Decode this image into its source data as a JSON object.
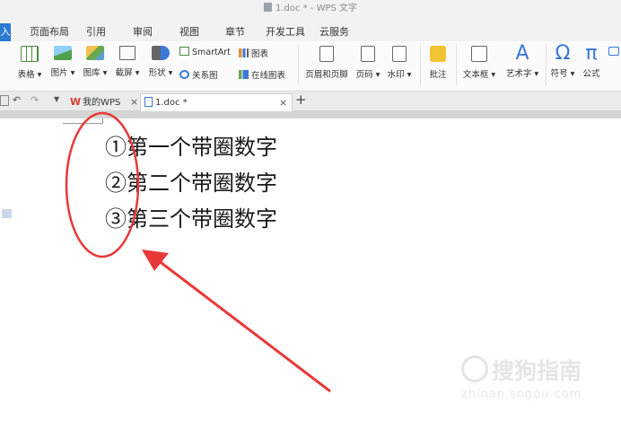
{
  "window": {
    "title": "1.doc * - WPS 文字"
  },
  "menu_tabs": [
    "入",
    "页面布局",
    "引用",
    "审阅",
    "视图",
    "章节",
    "开发工具",
    "云服务"
  ],
  "ribbon": {
    "table": "表格 ▾",
    "picture": "图片 ▾",
    "gallery": "图库 ▾",
    "screenshot": "截屏 ▾",
    "shape": "形状 ▾",
    "smartart": "SmartArt",
    "chart": "图表",
    "relation": "关系图",
    "online_chart": "在线图表",
    "header_footer": "页眉和页脚",
    "page_num": "页码 ▾",
    "watermark": "水印 ▾",
    "comment": "批注",
    "textbox": "文本框 ▾",
    "wordart": "艺术字 ▾",
    "symbol": "符号 ▾",
    "formula": "公式",
    "omega_glyph": "Ω",
    "pi_glyph": "π",
    "wordart_glyph": "A"
  },
  "doc_tabs": {
    "my_wps": "我的WPS",
    "current": "1.doc *",
    "close": "×",
    "add": "+"
  },
  "document": {
    "lines": [
      "①第一个带圈数字",
      "②第二个带圈数字",
      "③第三个带圈数字"
    ]
  },
  "watermark": {
    "main": "搜狗指南",
    "sub": "zhinan.sogou.com"
  },
  "colors": {
    "accent": "#2c79d2",
    "annotation": "#e8393a",
    "wps_red": "#d83b2b"
  }
}
